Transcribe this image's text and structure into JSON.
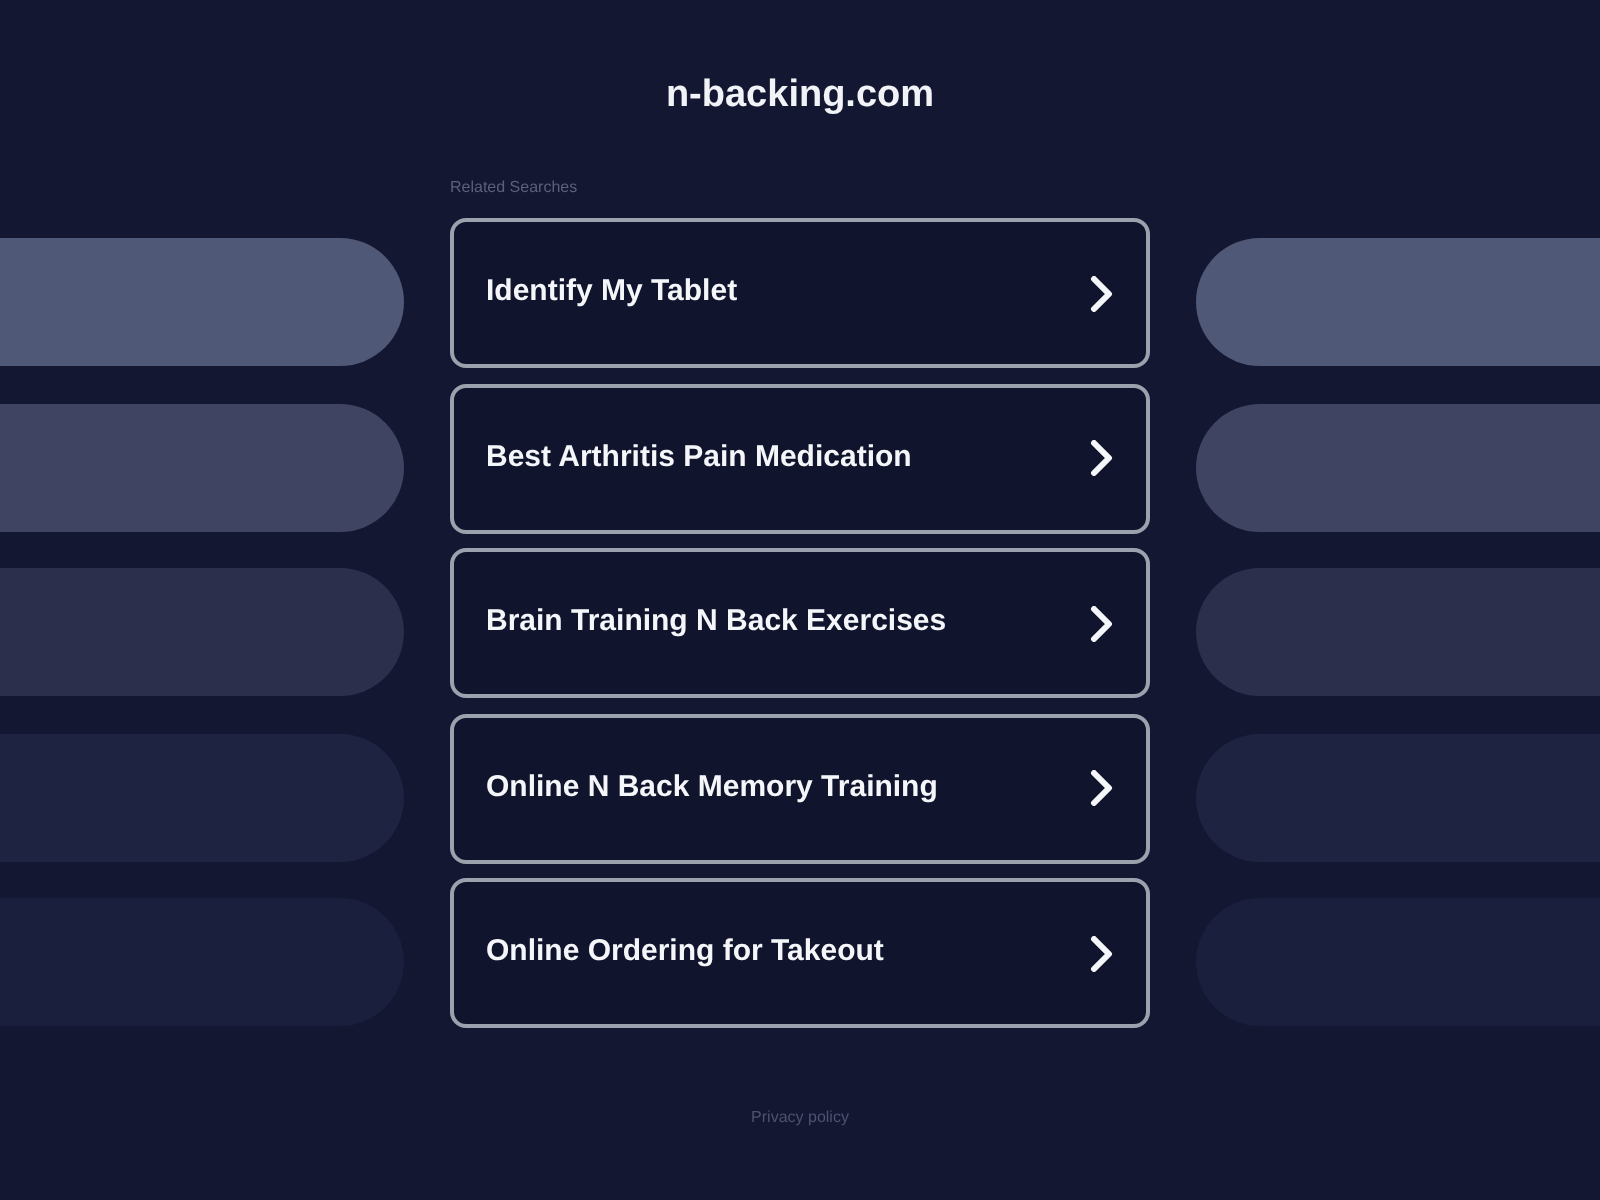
{
  "site_title": "n-backing.com",
  "related_label": "Related Searches",
  "links": [
    {
      "label": "Identify My Tablet"
    },
    {
      "label": "Best Arthritis Pain Medication"
    },
    {
      "label": "Brain Training N Back Exercises"
    },
    {
      "label": "Online N Back Memory Training"
    },
    {
      "label": "Online Ordering for Takeout"
    }
  ],
  "footer_link": "Privacy policy"
}
